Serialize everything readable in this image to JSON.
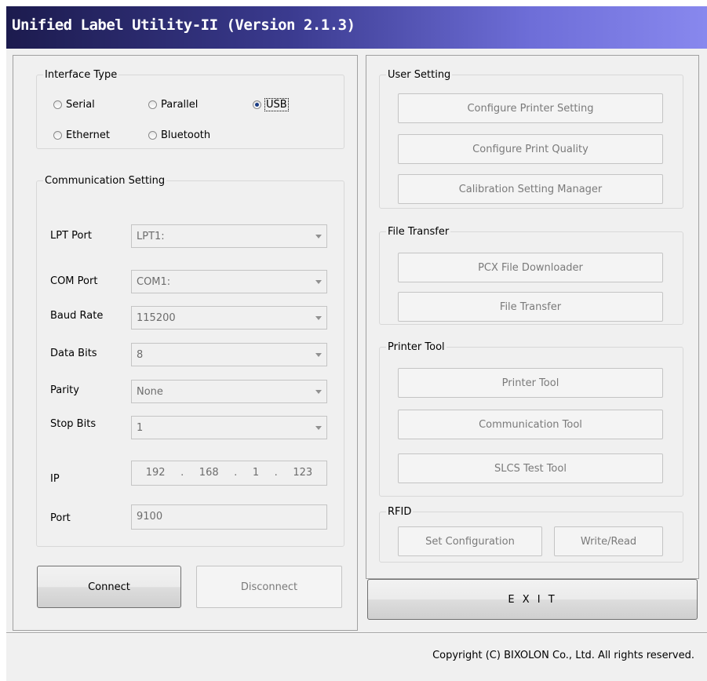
{
  "window": {
    "title": "Unified Label Utility-II (Version 2.1.3)"
  },
  "interface_type": {
    "legend": "Interface Type",
    "options": [
      "Serial",
      "Parallel",
      "USB",
      "Ethernet",
      "Bluetooth"
    ],
    "selected": "USB"
  },
  "communication": {
    "legend": "Communication Setting",
    "lpt_port": {
      "label": "LPT Port",
      "value": "LPT1:"
    },
    "com_port": {
      "label": "COM Port",
      "value": "COM1:"
    },
    "baud_rate": {
      "label": "Baud Rate",
      "value": "115200"
    },
    "data_bits": {
      "label": "Data Bits",
      "value": "8"
    },
    "parity": {
      "label": "Parity",
      "value": "None"
    },
    "stop_bits": {
      "label": "Stop Bits",
      "value": "1"
    },
    "ip": {
      "label": "IP",
      "octets": [
        "192",
        "168",
        "1",
        "123"
      ],
      "dot": "."
    },
    "port": {
      "label": "Port",
      "value": "9100"
    }
  },
  "actions": {
    "connect": "Connect",
    "disconnect": "Disconnect",
    "exit": "E X I T"
  },
  "user_setting": {
    "legend": "User Setting",
    "buttons": [
      "Configure Printer Setting",
      "Configure Print Quality",
      "Calibration Setting Manager"
    ]
  },
  "file_transfer": {
    "legend": "File Transfer",
    "buttons": [
      "PCX File Downloader",
      "File Transfer"
    ]
  },
  "printer_tool": {
    "legend": "Printer Tool",
    "buttons": [
      "Printer Tool",
      "Communication Tool",
      "SLCS Test Tool"
    ]
  },
  "rfid": {
    "legend": "RFID",
    "buttons": [
      "Set Configuration",
      "Write/Read"
    ]
  },
  "footer": {
    "copyright": "Copyright (C) BIXOLON Co., Ltd. All rights reserved."
  }
}
